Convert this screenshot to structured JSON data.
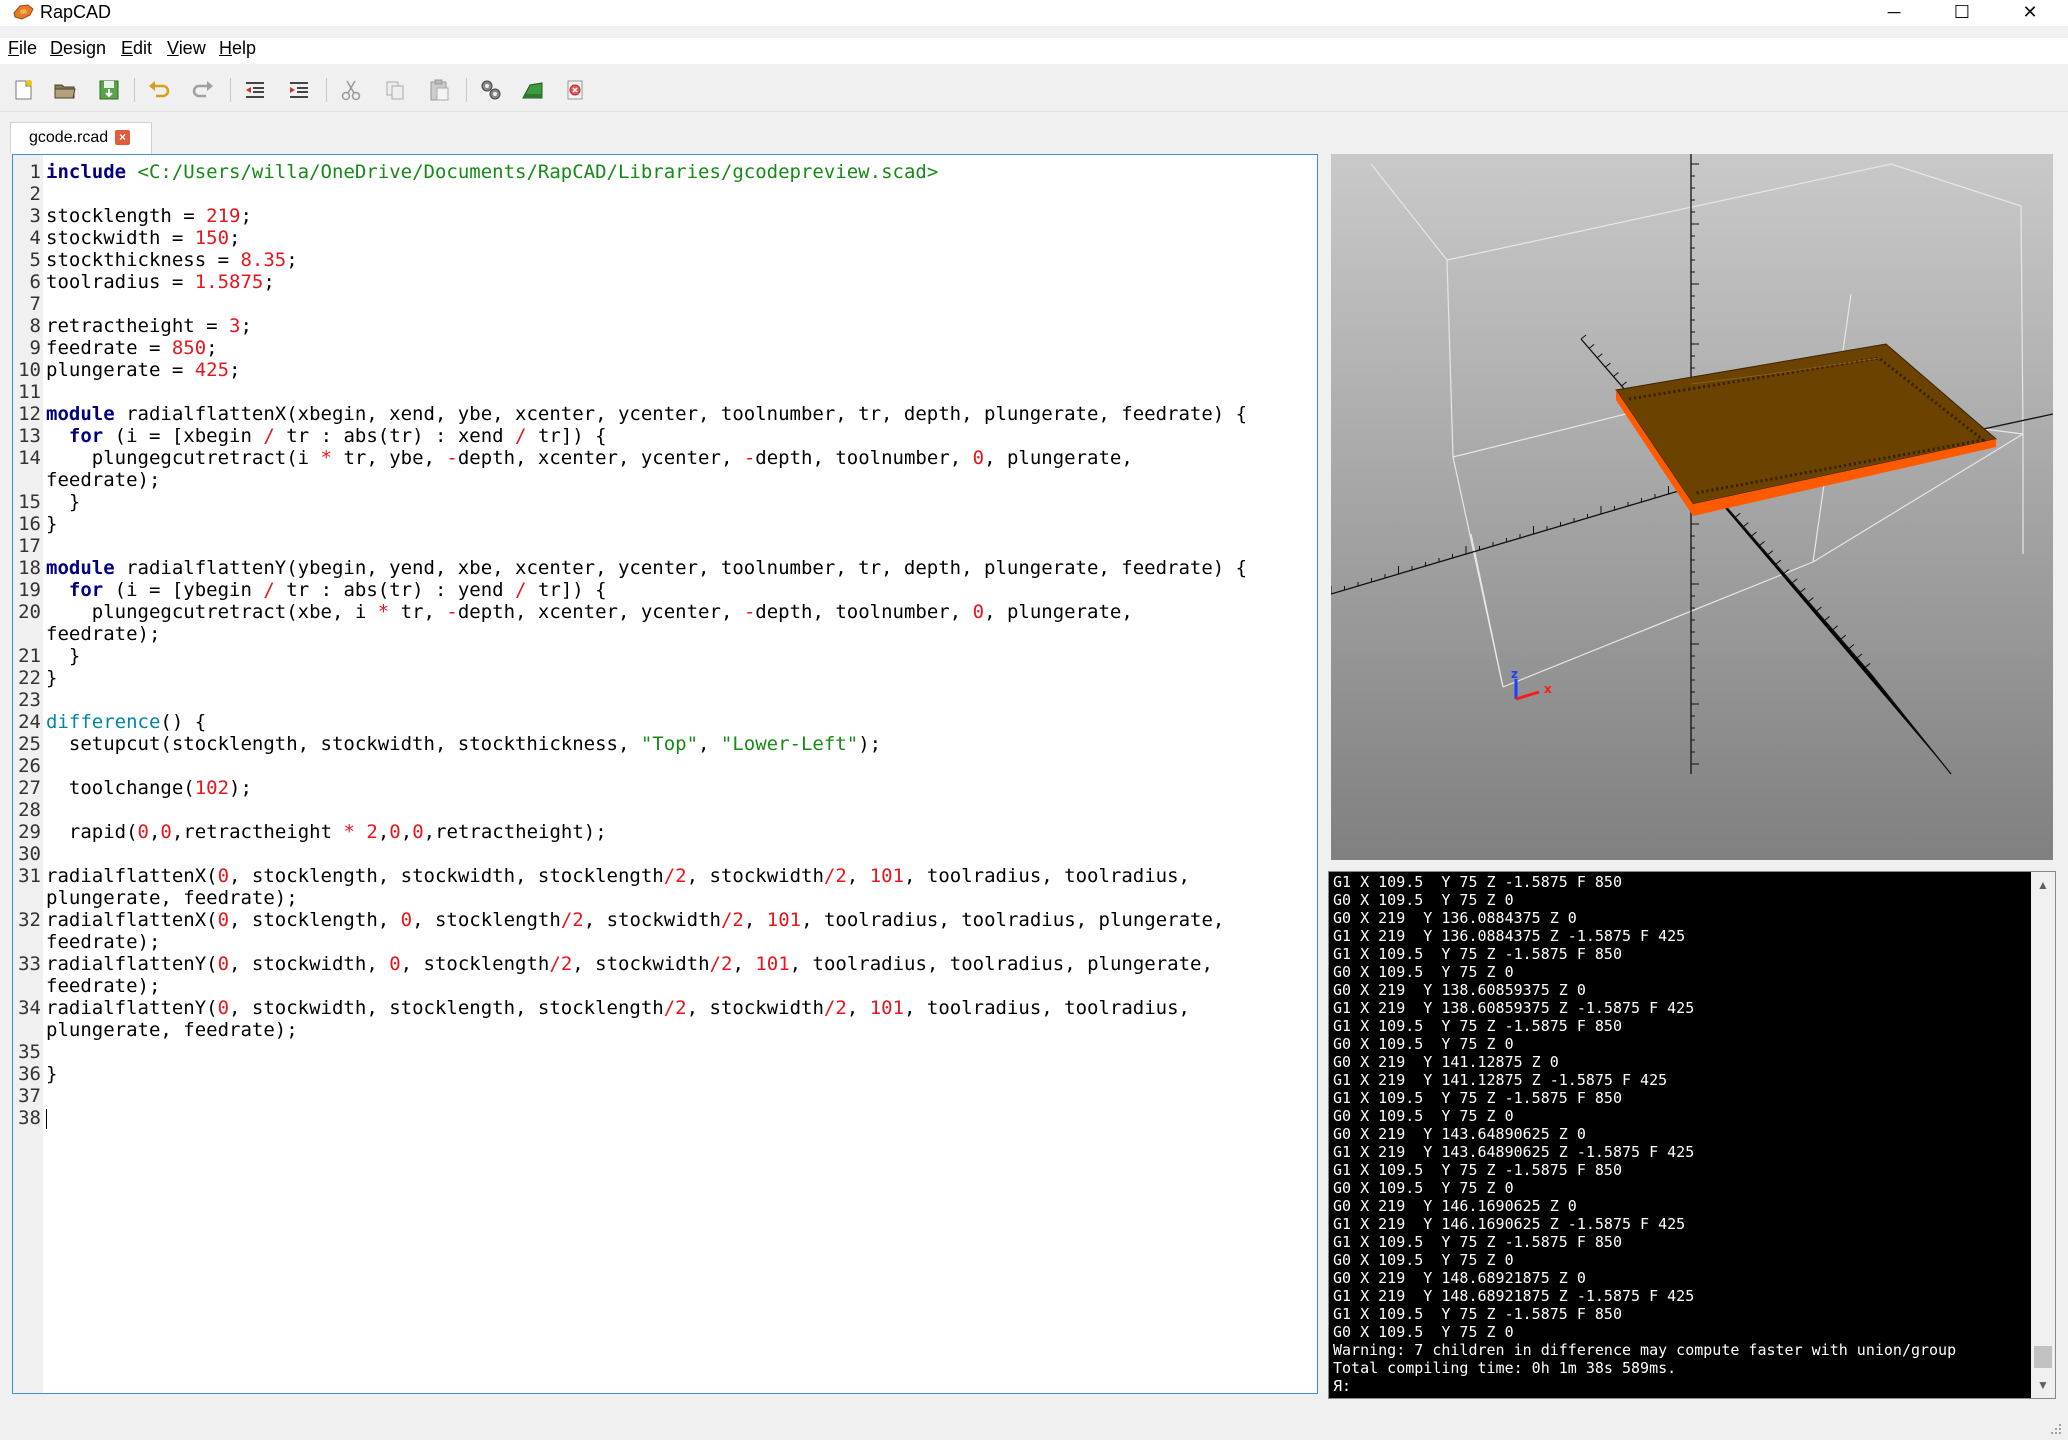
{
  "window": {
    "title": "RapCAD",
    "minimize_glyph": "─",
    "maximize_glyph": "☐",
    "close_glyph": "✕"
  },
  "menu": [
    {
      "label": "File",
      "accel": "F",
      "rest": "ile"
    },
    {
      "label": "Design",
      "accel": "D",
      "rest": "esign"
    },
    {
      "label": "Edit",
      "accel": "E",
      "rest": "dit"
    },
    {
      "label": "View",
      "accel": "V",
      "rest": "iew"
    },
    {
      "label": "Help",
      "accel": "H",
      "rest": "elp"
    }
  ],
  "toolbar": {
    "icons": [
      "new-file-icon",
      "open-folder-icon",
      "save-icon",
      "undo-icon",
      "redo-icon",
      "decrease-indent-icon",
      "increase-indent-icon",
      "cut-icon",
      "copy-icon",
      "paste-icon",
      "compile-icon",
      "generate-icon",
      "print-icon"
    ]
  },
  "tab": {
    "label": "gcode.rcad",
    "close_glyph": "×"
  },
  "editor": {
    "lines": [
      {
        "n": "1",
        "html": "<span class=\"kw\">include</span> <span class=\"inc\">&lt;C:/Users/willa/OneDrive/Documents/RapCAD/Libraries/gcodepreview.scad&gt;</span>"
      },
      {
        "n": "2",
        "html": ""
      },
      {
        "n": "3",
        "html": "stocklength = <span class=\"num\">219</span>;"
      },
      {
        "n": "4",
        "html": "stockwidth = <span class=\"num\">150</span>;"
      },
      {
        "n": "5",
        "html": "stockthickness = <span class=\"num\">8.35</span>;"
      },
      {
        "n": "6",
        "html": "toolradius = <span class=\"num\">1.5875</span>;"
      },
      {
        "n": "7",
        "html": ""
      },
      {
        "n": "8",
        "html": "retractheight = <span class=\"num\">3</span>;"
      },
      {
        "n": "9",
        "html": "feedrate = <span class=\"num\">850</span>;"
      },
      {
        "n": "10",
        "html": "plungerate = <span class=\"num\">425</span>;"
      },
      {
        "n": "11",
        "html": ""
      },
      {
        "n": "12",
        "html": "<span class=\"kw\">module</span> radialflattenX(xbegin, xend, ybe, xcenter, ycenter, toolnumber, tr, depth, plungerate, feedrate) {"
      },
      {
        "n": "13",
        "html": "  <span class=\"kw\">for</span> (i = [xbegin <span class=\"num\">/</span> tr : abs(tr) : xend <span class=\"num\">/</span> tr]) {"
      },
      {
        "n": "14",
        "html": "    plungegcutretract(i <span class=\"num\">*</span> tr, ybe, <span class=\"num\">-</span>depth, xcenter, ycenter, <span class=\"num\">-</span>depth, toolnumber, <span class=\"num\">0</span>, plungerate,"
      },
      {
        "n": "",
        "html": "feedrate);"
      },
      {
        "n": "15",
        "html": "  }"
      },
      {
        "n": "16",
        "html": "}"
      },
      {
        "n": "17",
        "html": ""
      },
      {
        "n": "18",
        "html": "<span class=\"kw\">module</span> radialflattenY(ybegin, yend, xbe, xcenter, ycenter, toolnumber, tr, depth, plungerate, feedrate) {"
      },
      {
        "n": "19",
        "html": "  <span class=\"kw\">for</span> (i = [ybegin <span class=\"num\">/</span> tr : abs(tr) : yend <span class=\"num\">/</span> tr]) {"
      },
      {
        "n": "20",
        "html": "    plungegcutretract(xbe, i <span class=\"num\">*</span> tr, <span class=\"num\">-</span>depth, xcenter, ycenter, <span class=\"num\">-</span>depth, toolnumber, <span class=\"num\">0</span>, plungerate,"
      },
      {
        "n": "",
        "html": "feedrate);"
      },
      {
        "n": "21",
        "html": "  }"
      },
      {
        "n": "22",
        "html": "}"
      },
      {
        "n": "23",
        "html": ""
      },
      {
        "n": "24",
        "html": "<span class=\"fn\">difference</span>() {"
      },
      {
        "n": "25",
        "html": "  setupcut(stocklength, stockwidth, stockthickness, <span class=\"str\">\"Top\"</span>, <span class=\"str\">\"Lower-Left\"</span>);"
      },
      {
        "n": "26",
        "html": ""
      },
      {
        "n": "27",
        "html": "  toolchange(<span class=\"num\">102</span>);"
      },
      {
        "n": "28",
        "html": ""
      },
      {
        "n": "29",
        "html": "  rapid(<span class=\"num\">0</span>,<span class=\"num\">0</span>,retractheight <span class=\"num\">*</span> <span class=\"num\">2</span>,<span class=\"num\">0</span>,<span class=\"num\">0</span>,retractheight);"
      },
      {
        "n": "30",
        "html": ""
      },
      {
        "n": "31",
        "html": "radialflattenX(<span class=\"num\">0</span>, stocklength, stockwidth, stocklength<span class=\"num\">/2</span>, stockwidth<span class=\"num\">/2</span>, <span class=\"num\">101</span>, toolradius, toolradius,"
      },
      {
        "n": "",
        "html": "plungerate, feedrate);"
      },
      {
        "n": "32",
        "html": "radialflattenX(<span class=\"num\">0</span>, stocklength, <span class=\"num\">0</span>, stocklength<span class=\"num\">/2</span>, stockwidth<span class=\"num\">/2</span>, <span class=\"num\">101</span>, toolradius, toolradius, plungerate,"
      },
      {
        "n": "",
        "html": "feedrate);"
      },
      {
        "n": "33",
        "html": "radialflattenY(<span class=\"num\">0</span>, stockwidth, <span class=\"num\">0</span>, stocklength<span class=\"num\">/2</span>, stockwidth<span class=\"num\">/2</span>, <span class=\"num\">101</span>, toolradius, toolradius, plungerate,"
      },
      {
        "n": "",
        "html": "feedrate);"
      },
      {
        "n": "34",
        "html": "radialflattenY(<span class=\"num\">0</span>, stockwidth, stocklength, stocklength<span class=\"num\">/2</span>, stockwidth<span class=\"num\">/2</span>, <span class=\"num\">101</span>, toolradius, toolradius,"
      },
      {
        "n": "",
        "html": "plungerate, feedrate);"
      },
      {
        "n": "35",
        "html": ""
      },
      {
        "n": "36",
        "html": "}"
      },
      {
        "n": "37",
        "html": ""
      },
      {
        "n": "38",
        "html": "<span class=\"cursor\"></span>"
      }
    ]
  },
  "console": {
    "lines": [
      "G1 X 109.5  Y 75 Z -1.5875 F 850",
      "G0 X 109.5  Y 75 Z 0",
      "G0 X 219  Y 136.0884375 Z 0",
      "G1 X 219  Y 136.0884375 Z -1.5875 F 425",
      "G1 X 109.5  Y 75 Z -1.5875 F 850",
      "G0 X 109.5  Y 75 Z 0",
      "G0 X 219  Y 138.60859375 Z 0",
      "G1 X 219  Y 138.60859375 Z -1.5875 F 425",
      "G1 X 109.5  Y 75 Z -1.5875 F 850",
      "G0 X 109.5  Y 75 Z 0",
      "G0 X 219  Y 141.12875 Z 0",
      "G1 X 219  Y 141.12875 Z -1.5875 F 425",
      "G1 X 109.5  Y 75 Z -1.5875 F 850",
      "G0 X 109.5  Y 75 Z 0",
      "G0 X 219  Y 143.64890625 Z 0",
      "G1 X 219  Y 143.64890625 Z -1.5875 F 425",
      "G1 X 109.5  Y 75 Z -1.5875 F 850",
      "G0 X 109.5  Y 75 Z 0",
      "G0 X 219  Y 146.1690625 Z 0",
      "G1 X 219  Y 146.1690625 Z -1.5875 F 425",
      "G1 X 109.5  Y 75 Z -1.5875 F 850",
      "G0 X 109.5  Y 75 Z 0",
      "G0 X 219  Y 148.68921875 Z 0",
      "G1 X 219  Y 148.68921875 Z -1.5875 F 425",
      "G1 X 109.5  Y 75 Z -1.5875 F 850",
      "G0 X 109.5  Y 75 Z 0",
      "Warning: 7 children in difference may compute faster with union/group",
      "Total compiling time: 0h 1m 38s 589ms.",
      "Я:"
    ]
  },
  "viewport": {
    "axis_x_label": "x",
    "axis_z_label": "z",
    "stock_top_color": "#6b4200",
    "stock_side_color": "#ff5a00"
  }
}
